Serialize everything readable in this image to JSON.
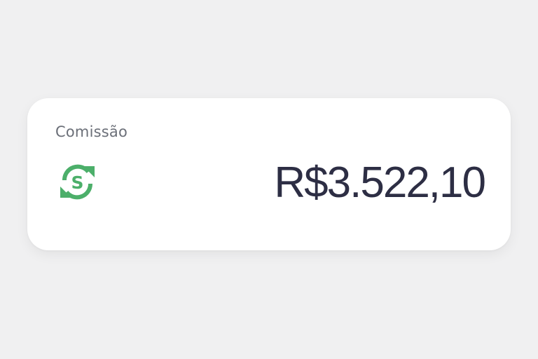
{
  "card": {
    "label": "Comissão",
    "amount": "R$3.522,10",
    "icon": "currency-exchange-icon",
    "icon_text": "S",
    "accent_color": "#4caf6a"
  }
}
